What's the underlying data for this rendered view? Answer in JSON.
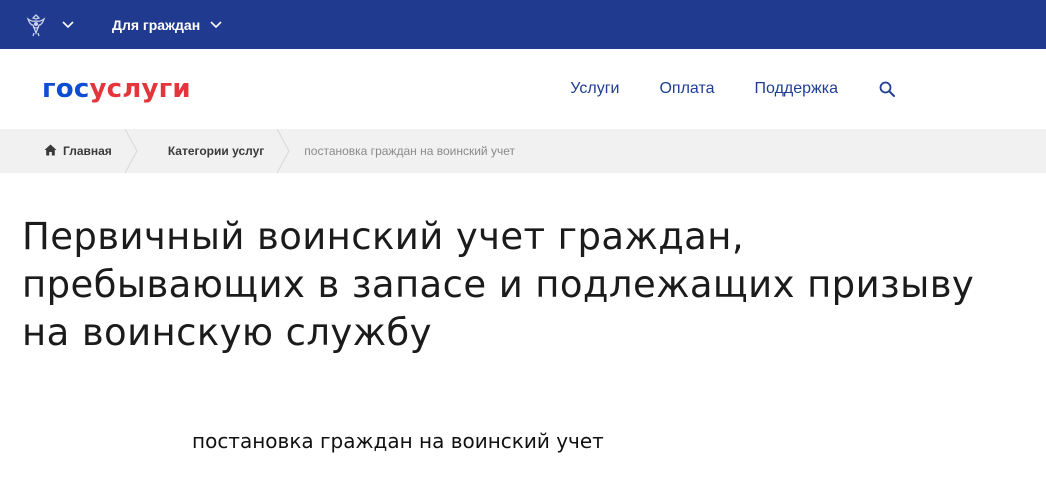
{
  "topbar": {
    "emblem_icon": "russian-coat-of-arms-icon",
    "citizens_label": "Для граждан",
    "bg_color": "#203a8f"
  },
  "header": {
    "logo_gos": "гос",
    "logo_uslugi": "услуги",
    "logo_colors": {
      "gos": "#0d4cd3",
      "uslugi": "#e3363c"
    },
    "nav": {
      "services": "Услуги",
      "payment": "Оплата",
      "support": "Поддержка"
    },
    "search_icon": "search-icon"
  },
  "breadcrumb": {
    "home": "Главная",
    "categories": "Категории услуг",
    "current": "постановка граждан на воинский учет"
  },
  "main": {
    "title": "Первичный воинский учет граждан, пребывающих в запасе и подлежащих призыву на воинскую службу",
    "subtitle": "постановка граждан на воинский учет"
  }
}
